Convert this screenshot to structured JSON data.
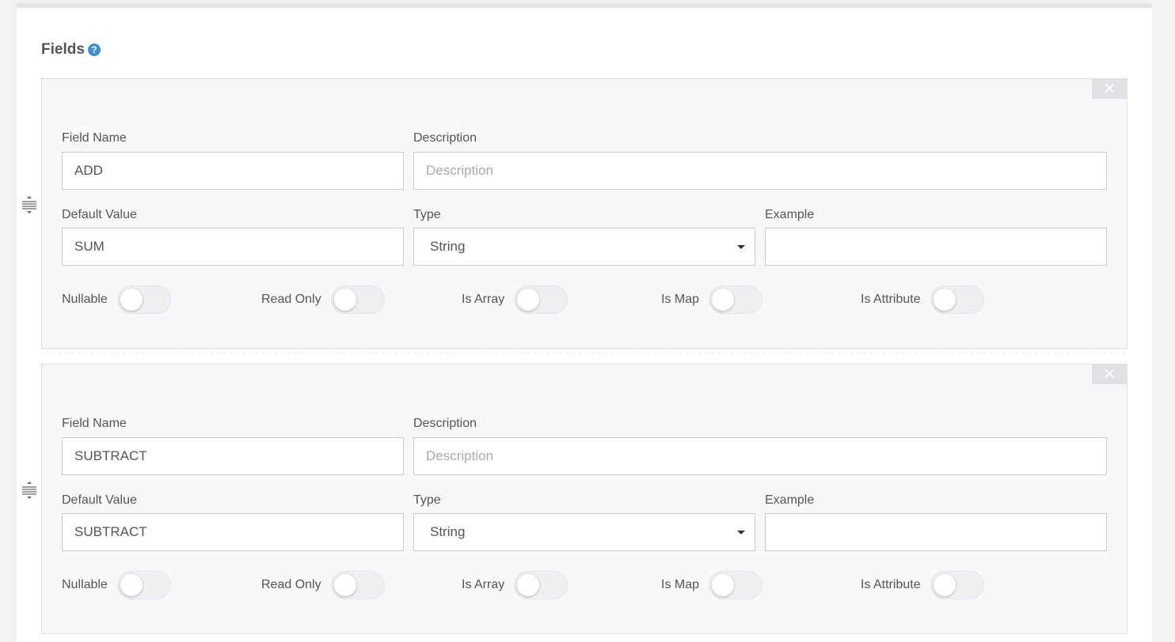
{
  "section": {
    "title": "Fields",
    "help_glyph": "?"
  },
  "labels": {
    "field_name": "Field Name",
    "description": "Description",
    "default_value": "Default Value",
    "type": "Type",
    "example": "Example",
    "nullable": "Nullable",
    "read_only": "Read Only",
    "is_array": "Is Array",
    "is_map": "Is Map",
    "is_attribute": "Is Attribute",
    "remove_glyph": "✕"
  },
  "fields": [
    {
      "field_name": "ADD",
      "description": "",
      "description_placeholder": "Description",
      "default_value": "SUM",
      "type": "String",
      "example": "",
      "nullable": false,
      "read_only": false,
      "is_array": false,
      "is_map": false,
      "is_attribute": false
    },
    {
      "field_name": "SUBTRACT",
      "description": "",
      "description_placeholder": "Description",
      "default_value": "SUBTRACT",
      "type": "String",
      "example": "",
      "nullable": false,
      "read_only": false,
      "is_array": false,
      "is_map": false,
      "is_attribute": false
    }
  ],
  "icons": {
    "help": "help-icon",
    "close": "close-icon",
    "drag": "drag-handle-icon",
    "dropdown": "caret-down-icon"
  },
  "colors": {
    "help_icon": "#3b8fd9",
    "card_background": "#f7f8f9",
    "toggle_off": "#edeff1"
  }
}
